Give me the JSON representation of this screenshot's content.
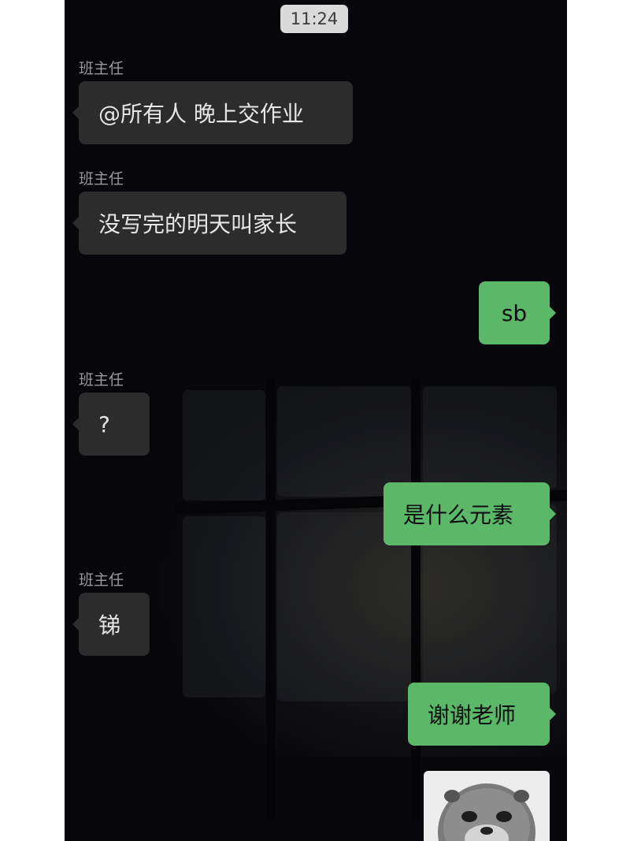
{
  "status": {
    "time": "11:24"
  },
  "messages": [
    {
      "sender": "班主任",
      "text": "@所有人 晚上交作业",
      "side": "in"
    },
    {
      "sender": "班主任",
      "text": "没写完的明天叫家长",
      "side": "in"
    },
    {
      "text": "sb",
      "side": "out"
    },
    {
      "sender": "班主任",
      "text": "?",
      "side": "in"
    },
    {
      "text": "是什么元素",
      "side": "out"
    },
    {
      "sender": "班主任",
      "text": "锑",
      "side": "in"
    },
    {
      "text": "谢谢老师",
      "side": "out"
    }
  ],
  "sticker": {
    "icon": "otter-sticker-icon"
  },
  "colors": {
    "background": "#07070b",
    "incoming_bubble": "#2c2c2c",
    "outgoing_bubble": "#5ab868",
    "time_pill": "#dadada"
  }
}
